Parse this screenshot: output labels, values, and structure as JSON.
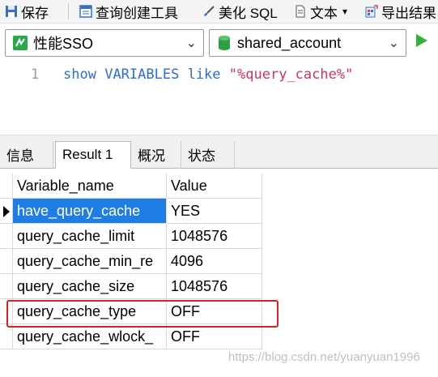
{
  "toolbar": {
    "save_label": "保存",
    "query_builder_label": "查询创建工具",
    "beautify_label": "美化 SQL",
    "text_label": "文本",
    "text_dropdown": "▾",
    "export_label": "导出结果"
  },
  "selectors": {
    "connection": "性能SSO",
    "database": "shared_account"
  },
  "editor": {
    "line_number": "1",
    "code_kw1": "show",
    "code_kw2": "VARIABLES",
    "code_kw3": "like",
    "code_str": "\"%query_cache%\""
  },
  "tabs": [
    {
      "label": "信息"
    },
    {
      "label": "Result 1"
    },
    {
      "label": "概况"
    },
    {
      "label": "状态"
    }
  ],
  "table": {
    "columns": [
      "Variable_name",
      "Value"
    ],
    "rows": [
      {
        "name": "have_query_cache",
        "value": "YES"
      },
      {
        "name": "query_cache_limit",
        "value": "1048576"
      },
      {
        "name": "query_cache_min_re",
        "value": "4096"
      },
      {
        "name": "query_cache_size",
        "value": "1048576"
      },
      {
        "name": "query_cache_type",
        "value": "OFF"
      },
      {
        "name": "query_cache_wlock_",
        "value": "OFF"
      }
    ]
  },
  "watermark": "https://blog.csdn.net/yuanyuan1996",
  "colors": {
    "selected_row": "#1e7ee5",
    "highlight_box": "#e02020",
    "keyword": "#2d6bd6",
    "string": "#d6305e"
  }
}
